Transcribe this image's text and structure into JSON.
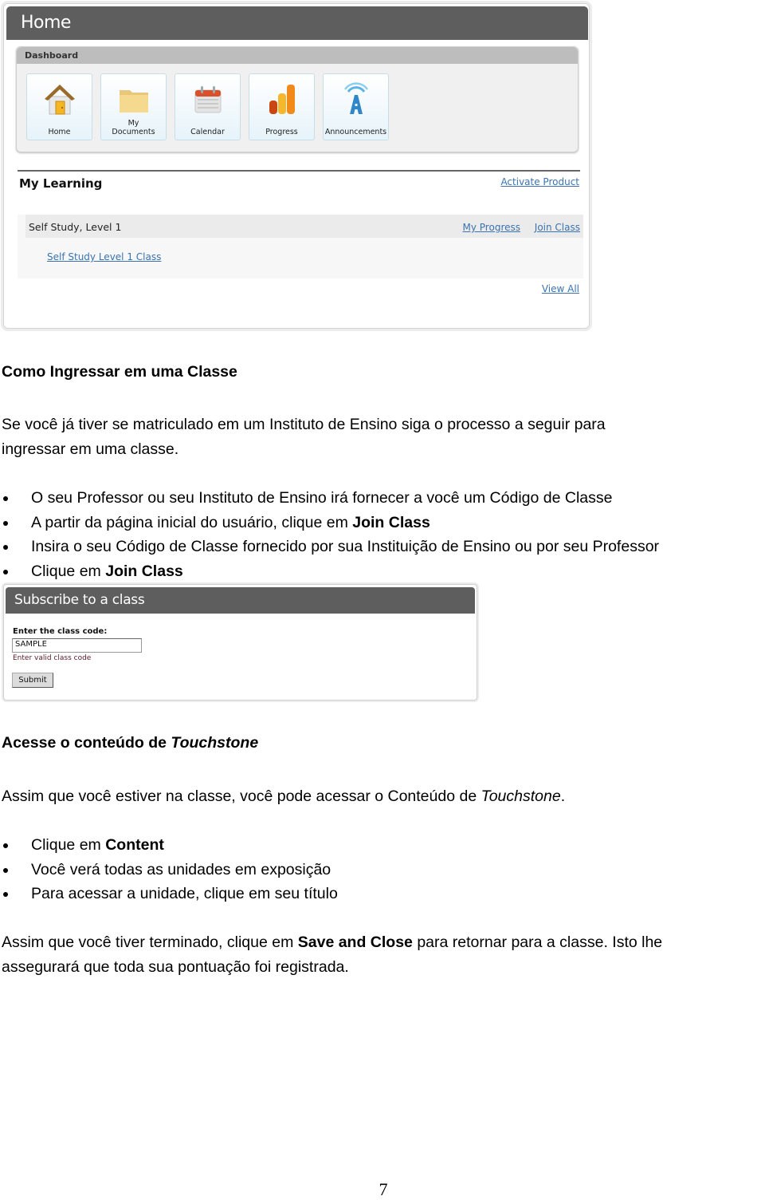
{
  "home_screenshot": {
    "title": "Home",
    "dashboard": {
      "header": "Dashboard",
      "tiles": [
        {
          "label": "Home",
          "icon": "house-icon"
        },
        {
          "label_line1": "My",
          "label_line2": "Documents",
          "icon": "folder-icon"
        },
        {
          "label": "Calendar",
          "icon": "calendar-icon"
        },
        {
          "label": "Progress",
          "icon": "bar-chart-icon"
        },
        {
          "label": "Announcements",
          "icon": "broadcast-a-icon"
        }
      ]
    },
    "my_learning": {
      "title": "My Learning",
      "activate_product": "Activate Product",
      "course": {
        "name": "Self Study, Level 1",
        "my_progress": "My Progress",
        "join_class": "Join Class",
        "class_link": "Self Study Level 1 Class"
      },
      "view_all": "View All"
    },
    "colors": {
      "titlebar": "#5e5e5e",
      "link": "#3a73b0"
    }
  },
  "section1": {
    "heading": "Como Ingressar em uma Classe",
    "intro_line1": "Se você já tiver se matriculado em um Instituto de Ensino siga o processo a seguir para",
    "intro_line2": "ingressar em uma classe.",
    "bullets": [
      {
        "text": "O seu Professor ou seu Instituto de Ensino irá fornecer a você um Código de Classe"
      },
      {
        "text": "A partir da página inicial do usuário, clique em ",
        "bold": "Join Class"
      },
      {
        "text": "Insira o seu Código de Classe fornecido por sua Instituição de Ensino ou por seu Professor"
      },
      {
        "text": "Clique em ",
        "bold": "Join Class"
      }
    ]
  },
  "subscribe_screenshot": {
    "title": "Subscribe to a class",
    "label": "Enter the class code:",
    "input_value": "SAMPLE",
    "hint": "Enter valid class code",
    "submit": "Submit"
  },
  "section2": {
    "heading_prefix": "Acesse o conteúdo de ",
    "heading_italic": "Touchstone",
    "intro_prefix": "Assim que você estiver na classe, você pode acessar o Conteúdo de ",
    "intro_italic": "Touchstone",
    "intro_suffix": ".",
    "bullets": [
      {
        "text": "Clique em ",
        "bold": "Content"
      },
      {
        "text": "Você verá todas as unidades em exposição"
      },
      {
        "text": "Para acessar a unidade, clique em seu título"
      }
    ],
    "closing_prefix": "Assim que você tiver terminado, clique em ",
    "closing_bold": "Save and Close",
    "closing_suffix": " para retornar para a classe. Isto lhe",
    "closing_line2": "assegurará que toda sua pontuação foi registrada."
  },
  "page_number": "7"
}
